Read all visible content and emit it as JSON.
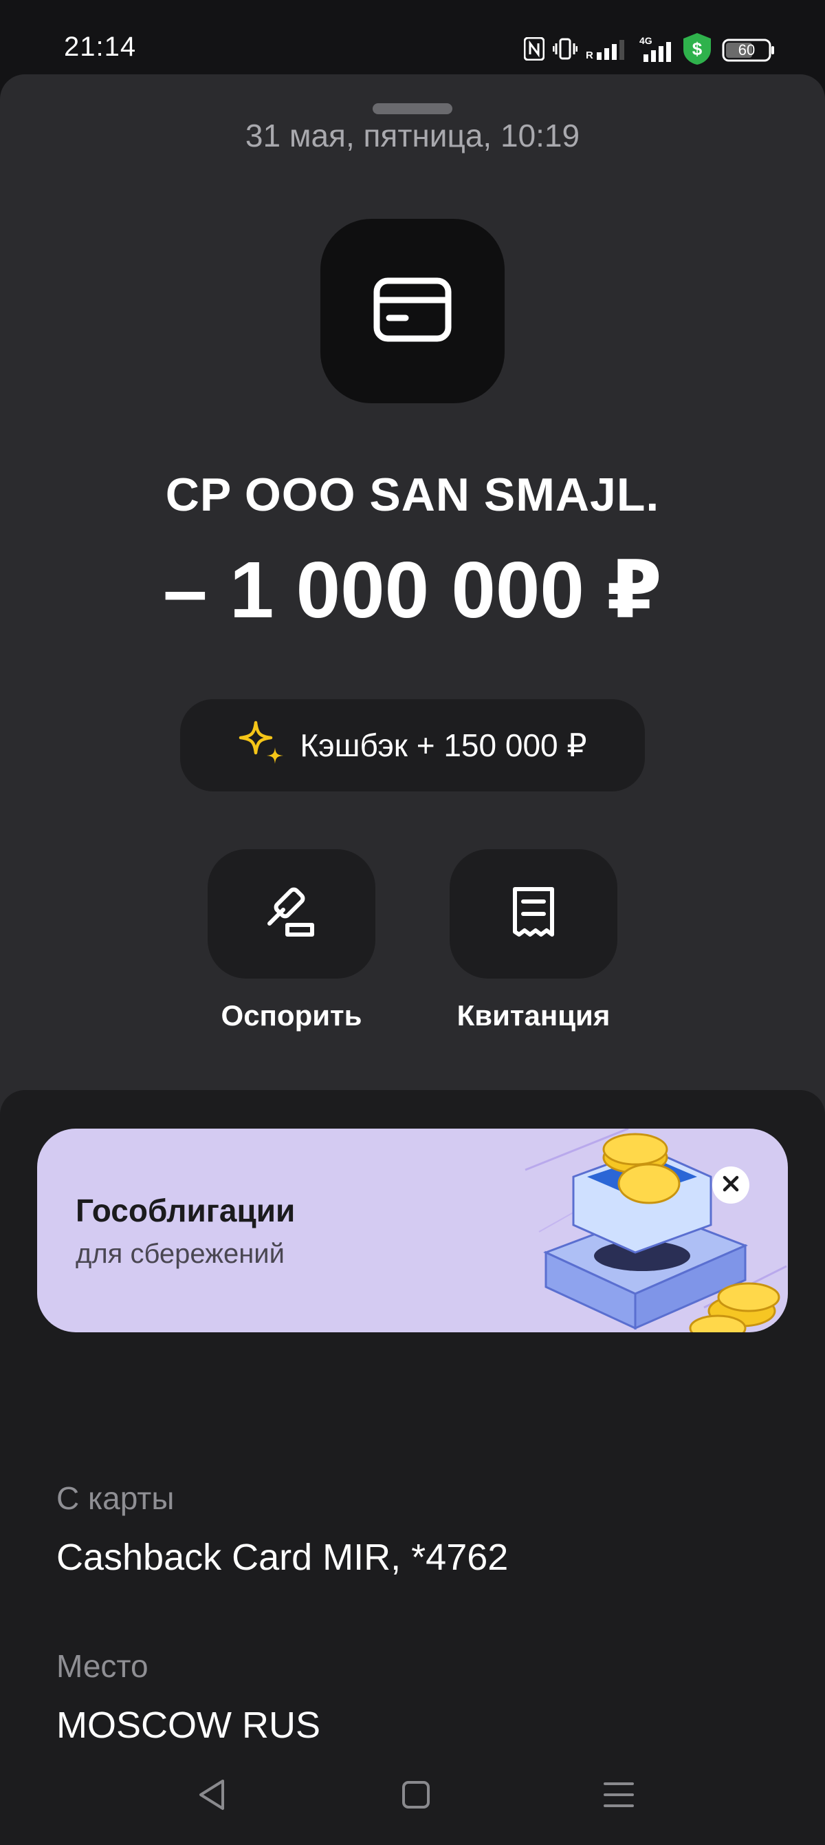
{
  "status_bar": {
    "time": "21:14",
    "battery": "60",
    "network": "4G",
    "icons": [
      "nfc-icon",
      "vibrate-icon",
      "signal-roaming-icon",
      "signal-4g-icon",
      "shield-dollar-icon",
      "battery-icon"
    ]
  },
  "transaction": {
    "date": "31 мая, пятница, 10:19",
    "merchant": "CP OOO SAN SMAJL.",
    "amount": "– 1 000 000 ₽",
    "merchant_icon": "credit-card-icon"
  },
  "cashback": {
    "label": "Кэшбэк + 150 000 ₽",
    "icon": "sparkles-icon",
    "accent": "#f5c518"
  },
  "actions": [
    {
      "label": "Оспорить",
      "icon": "gavel-icon"
    },
    {
      "label": "Квитанция",
      "icon": "receipt-icon"
    }
  ],
  "banner": {
    "title": "Гособлигации",
    "subtitle": "для сбережений",
    "background": "#d4cbf2",
    "close_icon": "close-icon",
    "art": "coins-box-illustration"
  },
  "details": [
    {
      "label": "С карты",
      "value": "Cashback Card MIR, *4762"
    },
    {
      "label": "Место",
      "value": "MOSCOW RUS"
    }
  ],
  "nav": {
    "icons": [
      "back-triangle-icon",
      "home-square-icon",
      "menu-lines-icon"
    ]
  }
}
